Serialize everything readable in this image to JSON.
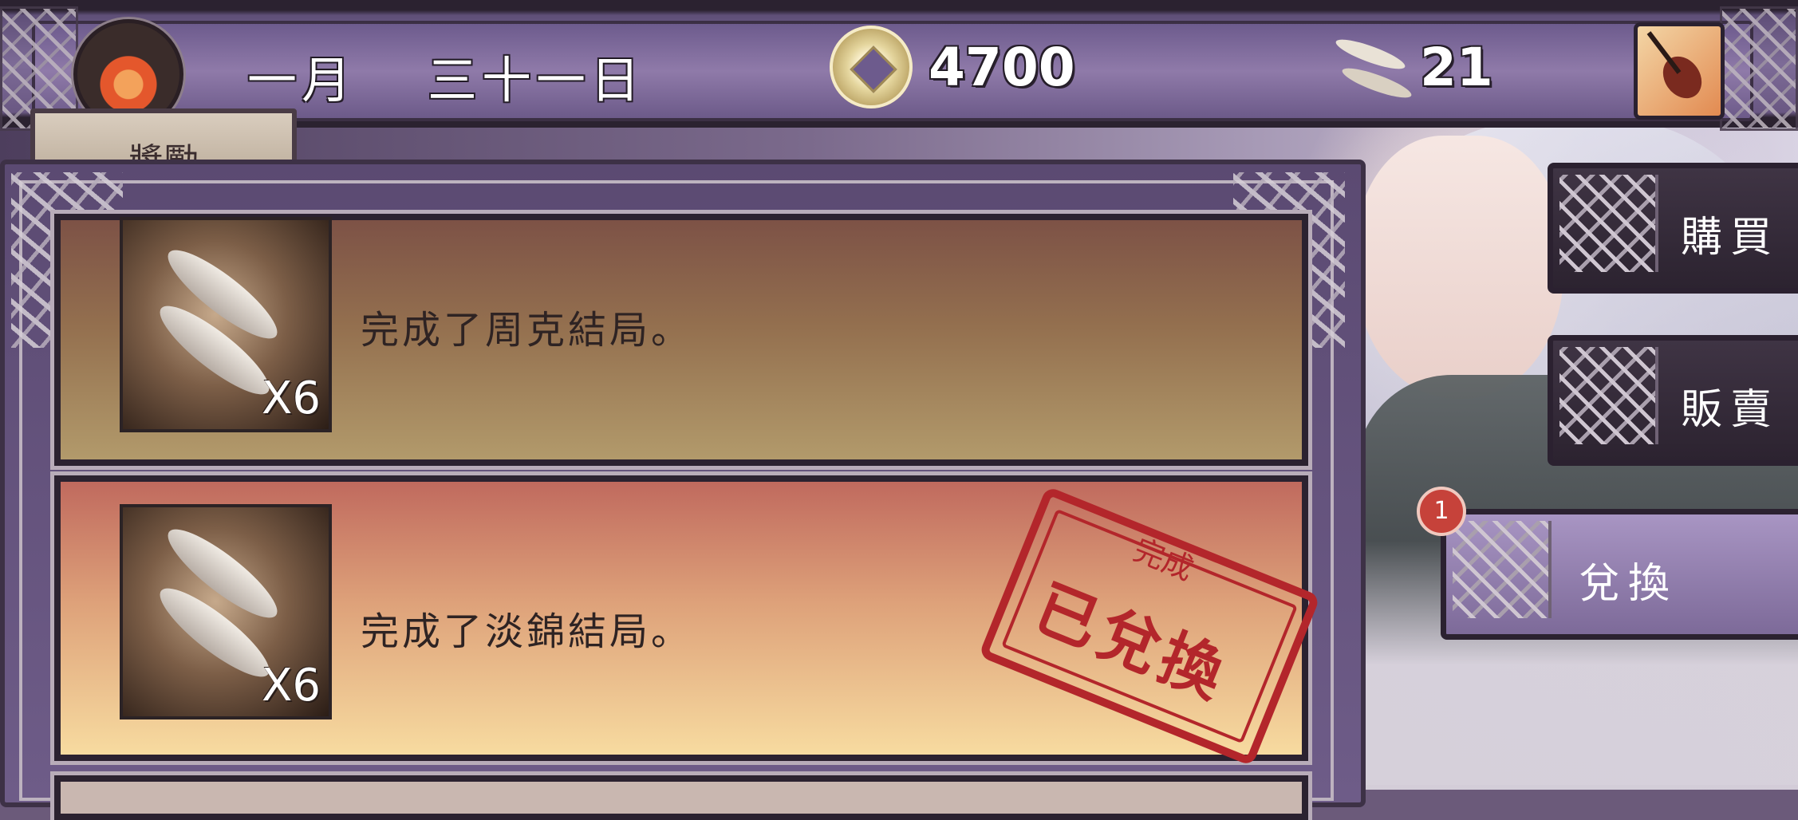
{
  "header": {
    "month": "一月",
    "day": "三十一日",
    "coins": "4700",
    "fish_count": "21"
  },
  "tab": {
    "label": "獎勵"
  },
  "rewards": [
    {
      "description": "完成了周克結局。",
      "quantity": "X6",
      "icon": "dried-fish-icon",
      "redeemed": false
    },
    {
      "description": "完成了淡錦結局。",
      "quantity": "X6",
      "icon": "dried-fish-icon",
      "redeemed": true
    }
  ],
  "stamp": {
    "small": "完成",
    "big": "已兌換",
    "color": "#b3262b"
  },
  "side_menu": {
    "buy": "購買",
    "sell": "販賣",
    "exchange": "兌換",
    "exchange_badge": "1"
  },
  "colors": {
    "accent": "#7d6b97",
    "stamp": "#b3262b",
    "badge": "#c6423a"
  }
}
